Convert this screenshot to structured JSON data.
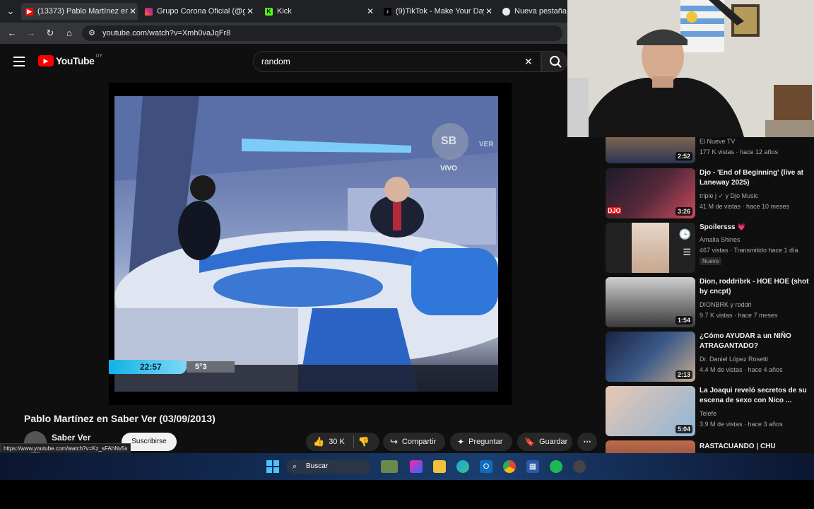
{
  "browser": {
    "tabs": [
      {
        "label": "(13373) Pablo Martínez en Sa",
        "favicon": "youtube-favicon"
      },
      {
        "label": "Grupo Corona Oficial (@gru",
        "favicon": "instagram-favicon"
      },
      {
        "label": "Kick",
        "favicon": "kick-favicon"
      },
      {
        "label": "(9)TikTok - Make Your Day",
        "favicon": "tiktok-favicon"
      },
      {
        "label": "Nueva pestaña",
        "favicon": "chrome-favicon"
      }
    ],
    "url": "youtube.com/watch?v=Xmh0vaJqFr8"
  },
  "youtube": {
    "logo_text": "YouTube",
    "region": "UY",
    "search_value": "random"
  },
  "video": {
    "overlay_time": "22:57",
    "overlay_temp": "5°3",
    "overlay_live": "VIVO",
    "overlay_logo": "SB",
    "overlay_brand": "VER",
    "title": "Pablo Martínez en Saber Ver (03/09/2013)",
    "channel": "Saber Ver",
    "subscribe_label": "Suscribirse",
    "likes": "30 K",
    "share_label": "Compartir",
    "ask_label": "Preguntar",
    "save_label": "Guardar"
  },
  "status_url": "https://www.youtube.com/watch?v=Kz_sFAhNv5s",
  "recommendations": [
    {
      "title": "",
      "channel": "El Nueve TV",
      "meta": "177 K vistas · hace 12 años",
      "duration": "2:52"
    },
    {
      "title": "Djo - 'End of Beginning' (live at Laneway 2025)",
      "channel": "triple j ✓ y Djo Music",
      "meta": "41 M de vistas · hace 10 meses",
      "duration": "3:26"
    },
    {
      "title": "Spoilersss 💗",
      "channel": "Amalia Shines",
      "meta": "467 vistas · Transmitido hace 1 día",
      "badge": "Nuevo"
    },
    {
      "title": "Dion, roddribrk - HOE HOE (shot by cncpt)",
      "channel": "DIONBRK y roddri",
      "meta": "9.7 K vistas · hace 7 meses",
      "duration": "1:54"
    },
    {
      "title": "¿Cómo AYUDAR a un NIÑO ATRAGANTADO?",
      "channel": "Dr. Daniel López Rosetti",
      "meta": "4.4 M de vistas · hace 4 años",
      "duration": "2:13"
    },
    {
      "title": "La Joaqui reveló secretos de su escena de sexo con Nico ...",
      "channel": "Telefe",
      "meta": "3.9 M de vistas · hace 3 años",
      "duration": "5:04"
    },
    {
      "title": "RASTACUANDO | CHU",
      "channel": "",
      "meta": ""
    }
  ],
  "taskbar": {
    "search_placeholder": "Buscar"
  },
  "colors": {
    "youtube_red": "#ff0000",
    "bg": "#0f0f0f"
  }
}
